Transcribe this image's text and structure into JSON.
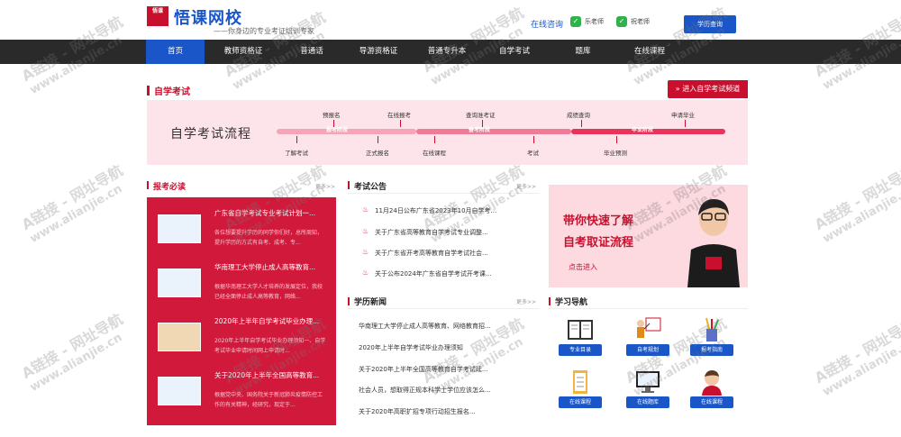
{
  "brand": {
    "logo_text": "悟课网校",
    "slogan": "——你身边的专业考证培训专家",
    "logo_mark": "悟课"
  },
  "header": {
    "consult_label": "在线咨询",
    "teachers": [
      "乐老师",
      "祝老师"
    ],
    "query_button": "学历查询"
  },
  "nav": [
    "首页",
    "教师资格证",
    "普通话",
    "导游资格证",
    "普通专升本",
    "自学考试",
    "题库",
    "在线课程"
  ],
  "section": {
    "title": "自学考试",
    "enter_label": "进入自学考试频道"
  },
  "flow": {
    "title": "自学考试流程",
    "phases": [
      "报考阶段",
      "备考阶段",
      "毕业阶段"
    ],
    "top_steps": [
      "预报名",
      "在线报考",
      "查询准考证",
      "成绩查询",
      "申请毕业"
    ],
    "bottom_steps": [
      "了解考试",
      "正式报名",
      "在线课程",
      "考试",
      "毕业预测"
    ]
  },
  "col1": {
    "title": "报考必读",
    "more": "更多>>",
    "cards": [
      {
        "title": "广东省自学考试专业考试计划一...",
        "desc": "各位想要提升学历的同学你们好，总所周知，提升学历的方式有自考、成考、专..."
      },
      {
        "title": "华南理工大学停止成人高等教育...",
        "desc": "根据华南理工大学人才培养的发展定位，我校已经全面停止成人高等教育，网络..."
      },
      {
        "title": "2020年上半年自学考试毕业办理...",
        "desc": "2020年上半年自学考试毕业办理须知一、自学考试毕业申请时间网上申请时..."
      },
      {
        "title": "关于2020年上半年全国高等教育...",
        "desc": "根据党中央、国务院关于新冠肺炎疫情防控工作的有关精神，经研究，现定于..."
      }
    ]
  },
  "col2": {
    "notice_title": "考试公告",
    "notice_more": "更多>>",
    "notices": [
      "11月24日公布广东省2023年10月自学考...",
      "关于广东省高等教育自学考试专业调整...",
      "关于广东省开考高等教育自学考试社会...",
      "关于公布2024年广东省自学考试开考课..."
    ],
    "news_title": "学历新闻",
    "news_more": "更多>>",
    "news": [
      "华南理工大学停止成人高等教育、网络教育招...",
      "2020年上半年自学考试毕业办理须知",
      "关于2020年上半年全国高等教育自学考试延...",
      "社会人员，想取得正规本科学士学位应该怎么...",
      "关于2020年高职扩招专项行动招生报名..."
    ]
  },
  "promo": {
    "line1": "带你快速了解",
    "line2": "自考取证流程",
    "link": "点击进入"
  },
  "study": {
    "title": "学习导航",
    "items": [
      "专业目录",
      "自考规划",
      "报考指南",
      "在线课程",
      "在线题库",
      "在线课程"
    ],
    "icons": [
      "book-icon",
      "teacher-board-icon",
      "pencil-cup-icon",
      "checklist-icon",
      "monitor-icon",
      "student-avatar-icon"
    ]
  },
  "watermark": {
    "text": "A链接 - 网址导航",
    "url": "www.alianjie.cn"
  },
  "colors": {
    "primary_blue": "#1a56c8",
    "brand_red": "#c8102e",
    "panel_red": "#d11a3b",
    "nav_dark": "#2a2a2a",
    "flow_pink": "#fde4ea"
  }
}
